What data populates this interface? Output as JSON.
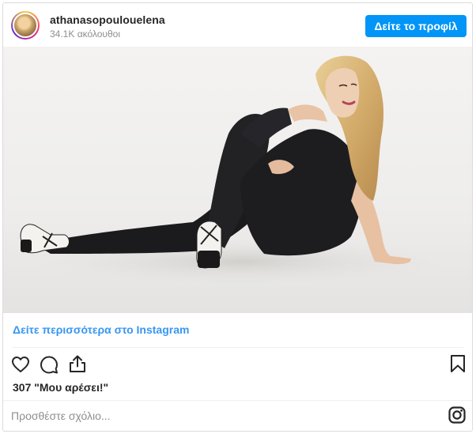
{
  "header": {
    "username": "athanasopoulouelena",
    "followers": "34.1K ακόλουθοι",
    "profile_button": "Δείτε το προφίλ"
  },
  "links": {
    "view_more": "Δείτε περισσότερα στο Instagram"
  },
  "actions": {
    "icons": [
      "heart-icon",
      "comment-icon",
      "share-icon",
      "bookmark-icon"
    ]
  },
  "likes": {
    "text": "307 \"Μου αρέσει!\""
  },
  "comment": {
    "placeholder": "Προσθέστε σχόλιο..."
  },
  "footer": {
    "logo_icon": "instagram-icon"
  },
  "colors": {
    "accent": "#0095f6",
    "link": "#3897f0",
    "text": "#262626",
    "muted": "#8e8e8e",
    "border": "#dbdbdb"
  }
}
